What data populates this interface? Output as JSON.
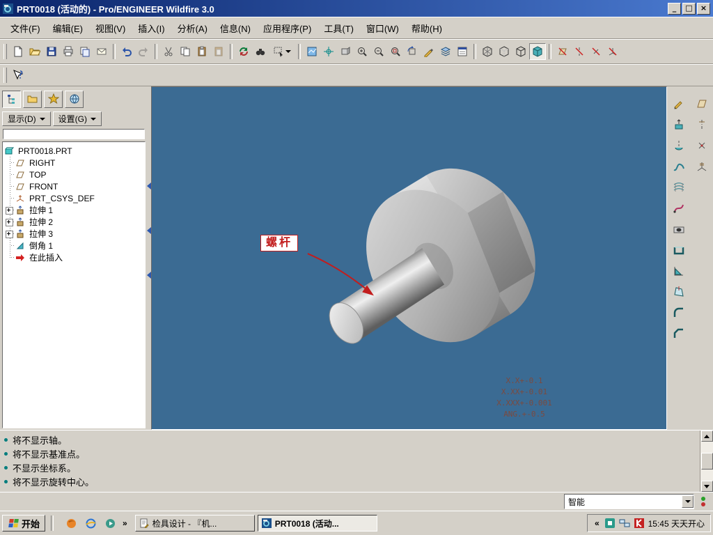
{
  "colors": {
    "chrome": "#d4d0c8",
    "title_grad_start": "#0a246a",
    "title_grad_end": "#4a7ad0",
    "viewport_bg": "#3b6b93",
    "annotation_red": "#c21d1d",
    "tolerance_color": "#7b4a3f",
    "bullet_teal": "#007d7d"
  },
  "titlebar": {
    "title": "PRT0018 (活动的) - Pro/ENGINEER Wildfire 3.0",
    "buttons": {
      "minimize": "_",
      "restore": "□",
      "close": "×"
    }
  },
  "menubar": {
    "items": [
      "文件(F)",
      "编辑(E)",
      "视图(V)",
      "插入(I)",
      "分析(A)",
      "信息(N)",
      "应用程序(P)",
      "工具(T)",
      "窗口(W)",
      "帮助(H)"
    ]
  },
  "toolbar": {
    "groups": [
      [
        "new-file",
        "open-file",
        "save",
        "print",
        "save-a-copy",
        "email"
      ],
      [
        "undo",
        "redo"
      ],
      [
        "cut",
        "copy",
        "paste",
        "paste-special"
      ],
      [
        "regenerate",
        "find",
        "select-filter"
      ],
      [
        "repaint",
        "spin-center",
        "orient-mode",
        "zoom-in",
        "zoom-out",
        "refit",
        "reorient",
        "annotations",
        "layers",
        "view-manager"
      ],
      [
        "wireframe",
        "hidden-line",
        "no-hidden",
        "shaded"
      ],
      [
        "datum-plane-display",
        "datum-axis-display",
        "datum-point-display",
        "csys-display"
      ]
    ],
    "help_row": [
      "context-help"
    ]
  },
  "tree_panel": {
    "tabs": [
      "model-tree",
      "folder-browser",
      "favorites",
      "connections"
    ],
    "display_button": "显示(D)",
    "settings_button": "设置(G)",
    "items": [
      {
        "label": "PRT0018.PRT",
        "icon": "part"
      },
      {
        "label": "RIGHT",
        "icon": "datum-plane"
      },
      {
        "label": "TOP",
        "icon": "datum-plane"
      },
      {
        "label": "FRONT",
        "icon": "datum-plane"
      },
      {
        "label": "PRT_CSYS_DEF",
        "icon": "csys"
      },
      {
        "label": "拉伸 1",
        "icon": "extrude",
        "expandable": true
      },
      {
        "label": "拉伸 2",
        "icon": "extrude",
        "expandable": true
      },
      {
        "label": "拉伸 3",
        "icon": "extrude",
        "expandable": true
      },
      {
        "label": "倒角 1",
        "icon": "chamfer"
      },
      {
        "label": "在此插入",
        "icon": "insert-here"
      }
    ]
  },
  "viewport": {
    "annotation_label": "螺杆",
    "tolerance_lines": [
      "X.X+-0.1",
      "X.XX+-0.01",
      "X.XXX+-0.001",
      "ANG.+-0.5"
    ]
  },
  "right_toolbar": {
    "feature_tools": [
      "sketch",
      "extrude",
      "revolve",
      "variable-sweep",
      "boundary-blend",
      "style",
      "hole",
      "shell",
      "rib",
      "draft",
      "round",
      "chamfer"
    ],
    "datum_tools": [
      "datum-plane",
      "datum-axis",
      "datum-point",
      "datum-csys"
    ]
  },
  "message_area": {
    "lines": [
      "将不显示轴。",
      "将不显示基准点。",
      "不显示坐标系。",
      "将不显示旋转中心。"
    ]
  },
  "statusbar": {
    "selection_filter": "智能"
  },
  "taskbar": {
    "start_label": "开始",
    "overflow_chevron": "»",
    "quick_launch": [
      "firefox",
      "internet-explorer",
      "media-player"
    ],
    "tasks": [
      {
        "label": "检具设计 - 『机...",
        "active": false
      },
      {
        "label": "PRT0018 (活动...",
        "active": true
      }
    ],
    "tray": {
      "chevron": "«",
      "icons": [
        "ime",
        "network",
        "kingsoft"
      ],
      "clock": "15:45 天天开心"
    }
  }
}
